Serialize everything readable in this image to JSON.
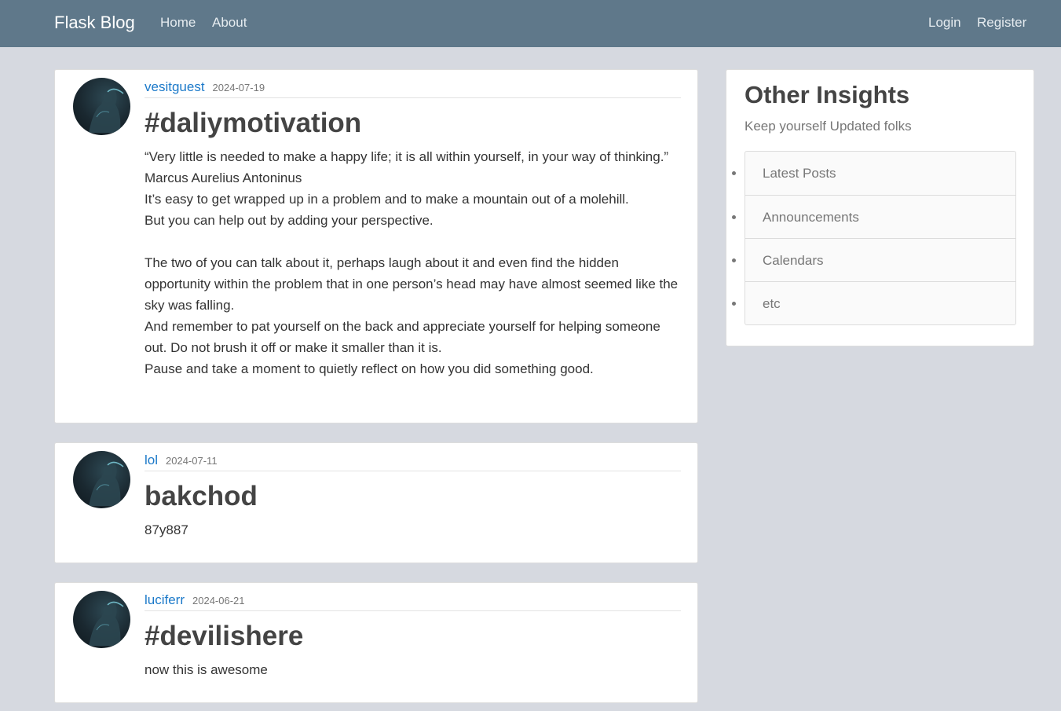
{
  "navbar": {
    "brand": "Flask Blog",
    "left_links": [
      "Home",
      "About"
    ],
    "right_links": [
      "Login",
      "Register"
    ],
    "background": "#5f788a"
  },
  "posts": [
    {
      "author": "vesitguest",
      "date": "2024-07-19",
      "title": "#daliymotivation",
      "content": [
        "“Very little is needed to make a happy life; it is all within yourself, in your way of thinking.”",
        "Marcus Aurelius Antoninus",
        "It’s easy to get wrapped up in a problem and to make a mountain out of a molehill.",
        "But you can help out by adding your perspective.",
        "",
        "The two of you can talk about it, perhaps laugh about it and even find the hidden opportunity within the problem that in one person’s head may have almost seemed like the sky was falling.",
        "And remember to pat yourself on the back and appreciate yourself for helping someone out. Do not brush it off or make it smaller than it is.",
        "Pause and take a moment to quietly reflect on how you did something good."
      ]
    },
    {
      "author": "lol",
      "date": "2024-07-11",
      "title": "bakchod",
      "content": [
        "87y887"
      ]
    },
    {
      "author": "luciferr",
      "date": "2024-06-21",
      "title": "#devilishere",
      "content": [
        "now this is awesome"
      ]
    }
  ],
  "sidebar": {
    "title": "Other Insights",
    "subtitle": "Keep yourself Updated folks",
    "items": [
      "Latest Posts",
      "Announcements",
      "Calendars",
      "etc"
    ]
  },
  "colors": {
    "page_background": "#d6d9e0",
    "author_link": "#1b79c9"
  }
}
